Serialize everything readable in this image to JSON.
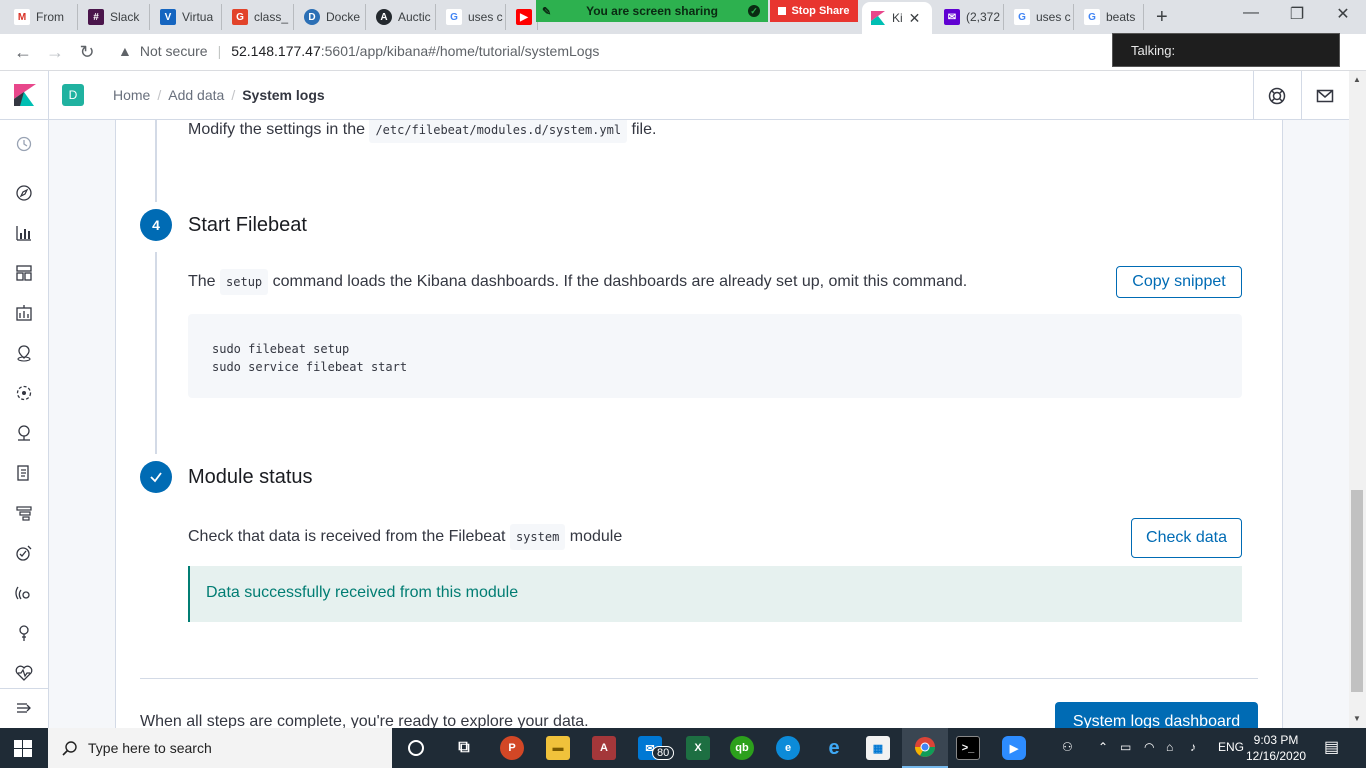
{
  "browser": {
    "tabs": [
      {
        "label": "From",
        "icon": "gmail-icon",
        "color": "#d93025"
      },
      {
        "label": "Slack",
        "icon": "slack-icon",
        "color": "#4a154b"
      },
      {
        "label": "Virtua",
        "icon": "virtual-icon",
        "color": "#1565c0"
      },
      {
        "label": "class_",
        "icon": "gitlab-icon",
        "color": "#e24329"
      },
      {
        "label": "Docke",
        "icon": "docker-icon",
        "color": "#2b6fb5"
      },
      {
        "label": "Auctic",
        "icon": "github-icon",
        "color": "#24292e"
      },
      {
        "label": "uses c",
        "icon": "google-icon",
        "color": "#4285f4"
      }
    ],
    "active_tab_label": "Ki",
    "right_tabs": [
      {
        "label": "(2,372",
        "icon": "yahoo-mail-icon",
        "color": "#6001d2"
      },
      {
        "label": "uses c",
        "icon": "google-icon",
        "color": "#4285f4"
      },
      {
        "label": "beats",
        "icon": "google-icon",
        "color": "#4285f4"
      }
    ],
    "new_tab": "+",
    "sharing_text": "You are screen sharing",
    "stop_share": "Stop Share",
    "not_secure": "Not secure",
    "url_host": "52.148.177.47",
    "url_path": ":5601/app/kibana#/home/tutorial/systemLogs",
    "talking": "Talking:"
  },
  "header": {
    "space_initial": "D",
    "breadcrumbs": [
      "Home",
      "Add data",
      "System logs"
    ]
  },
  "content": {
    "modify_prefix": "Modify the settings in the",
    "modify_path": "/etc/filebeat/modules.d/system.yml",
    "modify_suffix": "file.",
    "step4_number": "4",
    "step4_title": "Start Filebeat",
    "setup_prefix": "The",
    "setup_code": "setup",
    "setup_suffix": "command loads the Kibana dashboards. If the dashboards are already set up, omit this command.",
    "copy_snippet": "Copy snippet",
    "code_line1": "sudo filebeat setup",
    "code_line2": "sudo service filebeat start",
    "status_title": "Module status",
    "check_prefix": "Check that data is received from the Filebeat",
    "check_code": "system",
    "check_suffix": "module",
    "check_data": "Check data",
    "callout": "Data successfully received from this module",
    "complete_text": "When all steps are complete, you're ready to explore your data.",
    "dashboard_btn": "System logs dashboard"
  },
  "taskbar": {
    "search_placeholder": "Type here to search",
    "mail_badge": "80",
    "lang": "ENG",
    "time": "9:03 PM",
    "date": "12/16/2020"
  },
  "colors": {
    "accent": "#006bb4",
    "success": "#017d73",
    "share_green": "#2db14f",
    "stop_red": "#e8352f"
  }
}
